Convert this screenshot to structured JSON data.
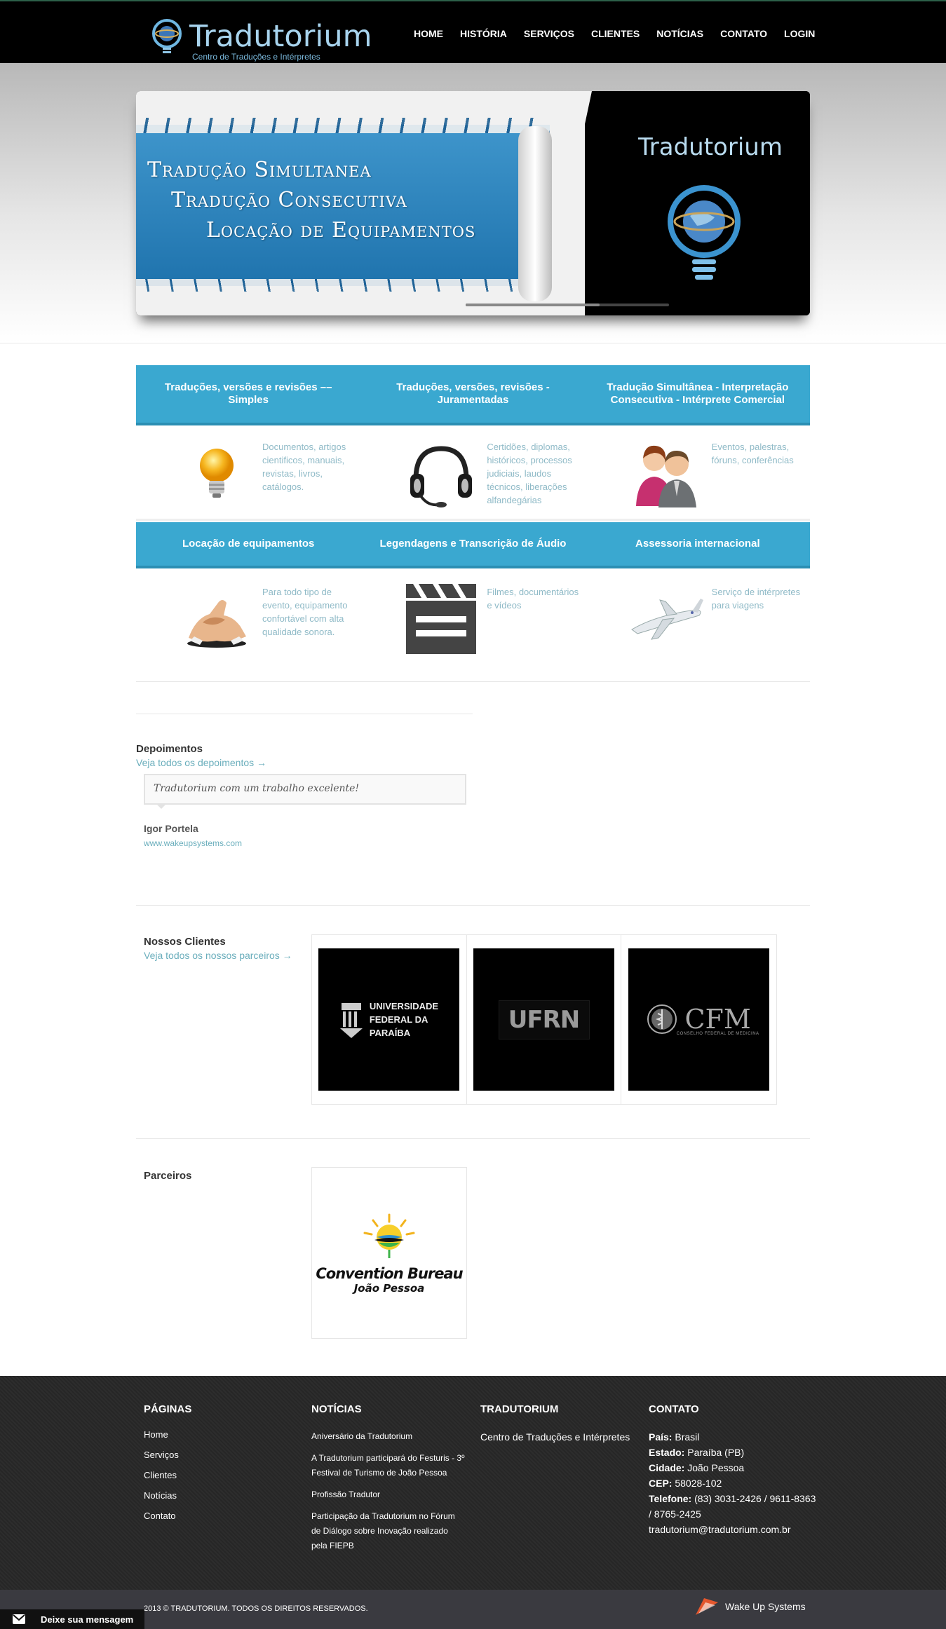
{
  "header": {
    "logo_text": "Tradutorium",
    "logo_sub": "Centro de Traduções e Intérpretes",
    "nav": [
      "HOME",
      "HISTÓRIA",
      "SERVIÇOS",
      "CLIENTES",
      "NOTÍCIAS",
      "CONTATO",
      "LOGIN"
    ]
  },
  "slider": {
    "lines": [
      "Tradução Simultanea",
      "Tradução Consecutiva",
      "Locação de Equipamentos"
    ],
    "brand": "Tradutorium",
    "progress": 0.66
  },
  "services": {
    "row1_titles": [
      "Traduções, versões e revisões –– Simples",
      "Traduções, versões, revisões - Juramentadas",
      "Tradução Simultânea - Interpretação Consecutiva - Intérprete Comercial"
    ],
    "row1_items": [
      {
        "icon": "lightbulb-icon",
        "desc": "Documentos, artigos cientificos,  manuais, revistas, livros, catálogos."
      },
      {
        "icon": "headset-icon",
        "desc": "Certidões, diplomas, históricos, processos judiciais, laudos técnicos, liberações alfandegárias"
      },
      {
        "icon": "people-icon",
        "desc": "Eventos, palestras, fóruns, conferências"
      }
    ],
    "row2_titles": [
      "Locação de equipamentos",
      "Legendagens e Transcrição de Áudio",
      "Assessoria internacional"
    ],
    "row2_items": [
      {
        "icon": "handshake-icon",
        "desc": "Para todo tipo de evento, equipamento confortável com alta qualidade sonora."
      },
      {
        "icon": "clapperboard-icon",
        "desc": "Filmes, documentários e vídeos"
      },
      {
        "icon": "airplane-icon",
        "desc": "Serviço de intérpretes para viagens"
      }
    ]
  },
  "testimonials": {
    "title": "Depoimentos",
    "link": "Veja todos os depoimentos →",
    "quote": "Tradutorium com um trabalho excelente!",
    "author": "Igor Portela",
    "site": "www.wakeupsystems.com"
  },
  "clients": {
    "title": "Nossos Clientes",
    "link": "Veja todos os nossos parceiros →",
    "logos": [
      {
        "name": "UNIVERSIDADE FEDERAL DA PARAÍBA"
      },
      {
        "name": "UFRN"
      },
      {
        "name": "CFM",
        "sub": "CONSELHO FEDERAL DE MEDICINA"
      }
    ]
  },
  "partners": {
    "title": "Parceiros",
    "logo_line1": "Convention Bureau",
    "logo_line2": "João Pessoa"
  },
  "footer": {
    "pages_title": "PÁGINAS",
    "pages": [
      "Home",
      "Serviços",
      "Clientes",
      "Notícias",
      "Contato"
    ],
    "news_title": "NOTÍCIAS",
    "news": [
      "Aniversário da Tradutorium",
      "A Tradutorium participará do Festuris - 3º Festival de Turismo de João Pessoa",
      "Profissão Tradutor",
      "Participação da Tradutorium no Fórum de Diálogo sobre Inovação realizado pela FIEPB"
    ],
    "about_title": "TRADUTORIUM",
    "about_text": "Centro de Traduções e Intérpretes",
    "contact_title": "CONTATO",
    "contact": [
      {
        "label": "País:",
        "value": "Brasil"
      },
      {
        "label": "Estado:",
        "value": "Paraíba (PB)"
      },
      {
        "label": "Cidade:",
        "value": "João Pessoa"
      },
      {
        "label": "CEP:",
        "value": "58028-102"
      },
      {
        "label": "Telefone:",
        "value": "(83) 3031-2426 / 9611-8363 / 8765-2425"
      }
    ],
    "email": "tradutorium@tradutorium.com.br",
    "copyright": "2013 © TRADUTORIUM. TODOS OS DIREITOS RESERVADOS.",
    "credit": "Wake Up Systems",
    "message_button": "Deixe sua mensagem"
  },
  "colors": {
    "accent_blue": "#3aa8d0",
    "link_teal": "#6aaebc",
    "header_bg": "#000000",
    "footer_bg": "#2a2a2a"
  }
}
